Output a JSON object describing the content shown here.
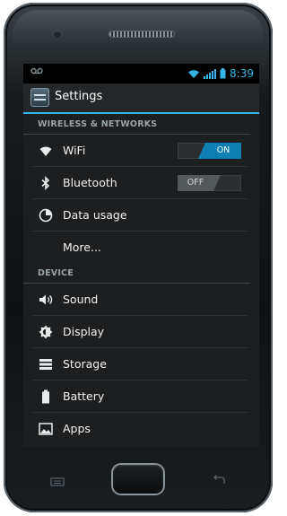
{
  "status_bar": {
    "time": "8:39",
    "voicemail_icon": "voicemail-icon",
    "wifi_icon": "wifi-signal-icon",
    "battery_icon": "battery-icon",
    "accent_color": "#33b5e5"
  },
  "action_bar": {
    "title": "Settings",
    "app_icon": "settings-app-icon"
  },
  "sections": [
    {
      "header": "WIRELESS & NETWORKS",
      "items": [
        {
          "label": "WiFi",
          "icon": "wifi-icon",
          "toggle": "ON"
        },
        {
          "label": "Bluetooth",
          "icon": "bluetooth-icon",
          "toggle": "OFF"
        },
        {
          "label": "Data usage",
          "icon": "data-usage-icon"
        },
        {
          "label": "More..."
        }
      ]
    },
    {
      "header": "DEVICE",
      "items": [
        {
          "label": "Sound",
          "icon": "speaker-icon"
        },
        {
          "label": "Display",
          "icon": "brightness-icon"
        },
        {
          "label": "Storage",
          "icon": "storage-icon"
        },
        {
          "label": "Battery",
          "icon": "battery-icon"
        },
        {
          "label": "Apps",
          "icon": "apps-icon"
        }
      ]
    }
  ],
  "hardware": {
    "home": "home-button",
    "menu": "menu-key-icon",
    "back": "back-key-icon"
  }
}
